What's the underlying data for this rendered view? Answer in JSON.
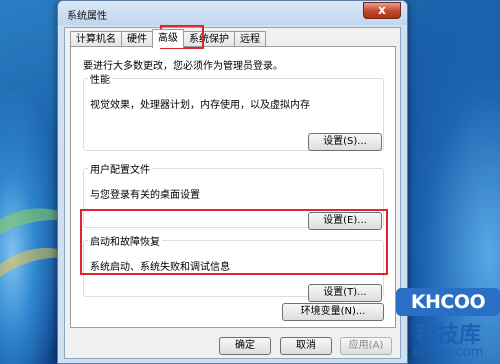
{
  "window": {
    "title": "系统属性",
    "close_glyph": "x"
  },
  "tabs": [
    {
      "label": "计算机名"
    },
    {
      "label": "硬件"
    },
    {
      "label": "高级"
    },
    {
      "label": "系统保护"
    },
    {
      "label": "远程"
    }
  ],
  "active_tab": "高级",
  "admin_note": "要进行大多数更改，您必须作为管理员登录。",
  "performance": {
    "title": "性能",
    "description": "视觉效果，处理器计划，内存使用，以及虚拟内存",
    "button": "设置(S)..."
  },
  "user_profiles": {
    "title": "用户配置文件",
    "description": "与您登录有关的桌面设置",
    "button": "设置(E)..."
  },
  "startup_recovery": {
    "title": "启动和故障恢复",
    "description": "系统启动、系统失败和调试信息",
    "button": "设置(T)..."
  },
  "env_button": "环境变量(N)...",
  "footer": {
    "ok": "确定",
    "cancel": "取消",
    "apply": "应用(A)"
  },
  "watermark": {
    "badge": "KHCOO",
    "name": "科技库",
    "url": "khcoo.com"
  },
  "colors": {
    "highlight": "#e0262a",
    "brand": "#2a6fc6"
  }
}
